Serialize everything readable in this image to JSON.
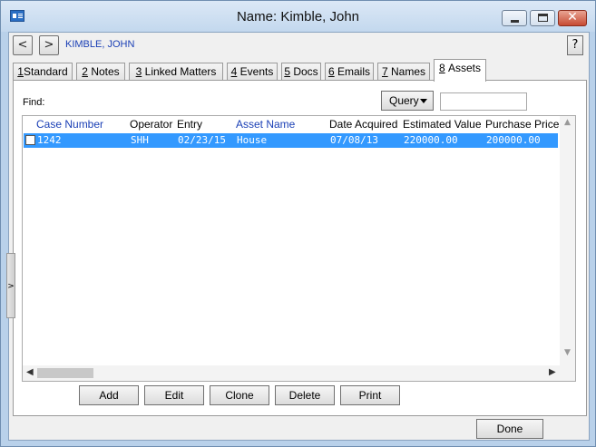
{
  "window": {
    "title": "Name: Kimble, John"
  },
  "header": {
    "record_name": "KIMBLE, JOHN",
    "prev_label": "<",
    "next_label": ">",
    "help_label": "?"
  },
  "tabs": [
    {
      "key": "1",
      "label": "Standard"
    },
    {
      "key": "2",
      "label": "Notes"
    },
    {
      "key": "3",
      "label": "Linked Matters"
    },
    {
      "key": "4",
      "label": "Events"
    },
    {
      "key": "5",
      "label": "Docs"
    },
    {
      "key": "6",
      "label": "Emails"
    },
    {
      "key": "7",
      "label": "Names"
    },
    {
      "key": "8",
      "label": "Assets",
      "active": true
    }
  ],
  "find": {
    "label": "Find:",
    "query_label": "Query",
    "value": ""
  },
  "grid": {
    "columns": [
      "Case Number",
      "Operator",
      "Entry",
      "Asset Name",
      "Date Acquired",
      "Estimated Value",
      "Purchase Price"
    ],
    "rows": [
      {
        "case_number": "1242",
        "operator": "SHH",
        "entry": "02/23/15",
        "asset_name": "House",
        "date_acquired": "07/08/13",
        "estimated_value": "220000.00",
        "purchase_price": "200000.00",
        "selected": true
      }
    ]
  },
  "actions": {
    "add": "Add",
    "edit": "Edit",
    "clone": "Clone",
    "delete": "Delete",
    "print": "Print"
  },
  "footer": {
    "done": "Done"
  },
  "colors": {
    "selection": "#3399ff",
    "link": "#1a3fb5"
  }
}
